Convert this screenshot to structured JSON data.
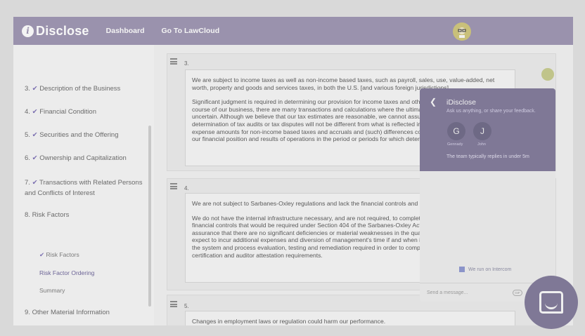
{
  "topbar": {
    "logo_icon": "i",
    "logo_text": "Disclose",
    "nav": [
      "Dashboard",
      "Go To LawCloud"
    ]
  },
  "sidebar": {
    "items": [
      {
        "number": "3.",
        "check": "✔",
        "label": "Description of the Business"
      },
      {
        "number": "4.",
        "check": "✔",
        "label": "Financial Condition"
      },
      {
        "number": "5.",
        "check": "✔",
        "label": "Securities and the Offering"
      },
      {
        "number": "6.",
        "check": "✔",
        "label": "Ownership and Capitalization"
      },
      {
        "number": "7.",
        "check": "✔",
        "label": "Transactions with Related Persons and Conflicts of Interest"
      },
      {
        "number": "8.",
        "check": "",
        "label": "Risk Factors"
      },
      {
        "number": "9.",
        "check": "",
        "label": "Other Material Information"
      }
    ],
    "subitems": [
      {
        "check": "✔",
        "label": "Risk Factors"
      },
      {
        "check": "",
        "label": "Risk Factor Ordering"
      },
      {
        "check": "",
        "label": "Summary"
      }
    ]
  },
  "cards": [
    {
      "number": "3.",
      "paragraphs": [
        "We are subject to income taxes as well as non-income based taxes, such as payroll, sales, use, value-added, net worth, property and goods and services taxes, in both the U.S. [and various foreign jurisdictions].",
        "Significant judgment is required in determining our provision for income taxes and other tax liabilities. In the ordinary course of our business, there are many transactions and calculations where the ultimate tax determination is uncertain. Although we believe that our tax estimates are reasonable, we cannot assure you that the final determination of tax audits or tax disputes will not be different from what is reflected in our income tax provisions, expense amounts for non-income based taxes and accruals and (such) differences could have an adverse effect on our financial position and results of operations in the period or periods for which determination is made."
      ]
    },
    {
      "number": "4.",
      "paragraphs": [
        "We are not subject to Sarbanes-Oxley regulations and lack the financial controls and procedures of public companies.",
        "We do not have the internal infrastructure necessary, and are not required, to complete an attestation about our financial controls that would be required under Section 404 of the Sarbanes-Oxley Act of 2002. There can be no assurance that there are no significant deficiencies or material weaknesses in the quality of our financial controls.  We expect to incur additional expenses and diversion of management's time if and when it becomes necessary to perform the system and process evaluation, testing and remediation required in order to comply with the management certification and auditor attestation requirements."
      ]
    },
    {
      "number": "5.",
      "paragraphs": [
        "Changes in employment laws or regulation could harm our performance."
      ]
    }
  ],
  "chat": {
    "back_icon": "chevron-left-icon",
    "title": "iDisclose",
    "subtitle": "Ask us anything, or share your feedback.",
    "agents": [
      {
        "initial": "G",
        "name": "Gennady"
      },
      {
        "initial": "J",
        "name": "John"
      }
    ],
    "reply_time": "The team typically replies in under 5m",
    "powered_by": "We run on Intercom",
    "input_placeholder": "Send a message...",
    "gif_label": "GIF"
  },
  "colors": {
    "brand": "#9a92ad",
    "chat_header": "#7f7896",
    "check": "#7b6fb0"
  }
}
